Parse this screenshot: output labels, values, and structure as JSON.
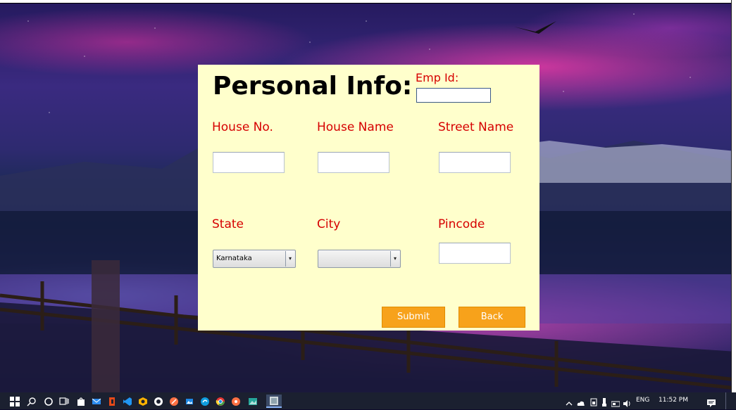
{
  "form": {
    "title": "Personal Info:",
    "emp_id_label": "Emp Id:",
    "emp_id_value": "",
    "labels": {
      "house_no": "House No.",
      "house_name": "House Name",
      "street_name": "Street Name",
      "state": "State",
      "city": "City",
      "pincode": "Pincode"
    },
    "values": {
      "house_no": "",
      "house_name": "",
      "street_name": "",
      "pincode": ""
    },
    "state_selected": "Karnataka",
    "city_selected": "",
    "submit_label": "Submit",
    "back_label": "Back"
  },
  "taskbar": {
    "language": "ENG",
    "time": "11:52 PM",
    "pinned_apps": [
      "start-icon",
      "search-icon",
      "cortana-icon",
      "task-view-icon",
      "store-icon",
      "mail-icon",
      "office-icon",
      "vscode-icon",
      "app-icon",
      "github-icon",
      "app2-icon",
      "photos-icon",
      "edge-icon",
      "chrome-icon",
      "app3-icon",
      "image-viewer-icon",
      "java-app-icon"
    ]
  },
  "colors": {
    "form_background": "#ffffcc",
    "label_color": "#d60000",
    "button_color": "#f7a21b"
  }
}
